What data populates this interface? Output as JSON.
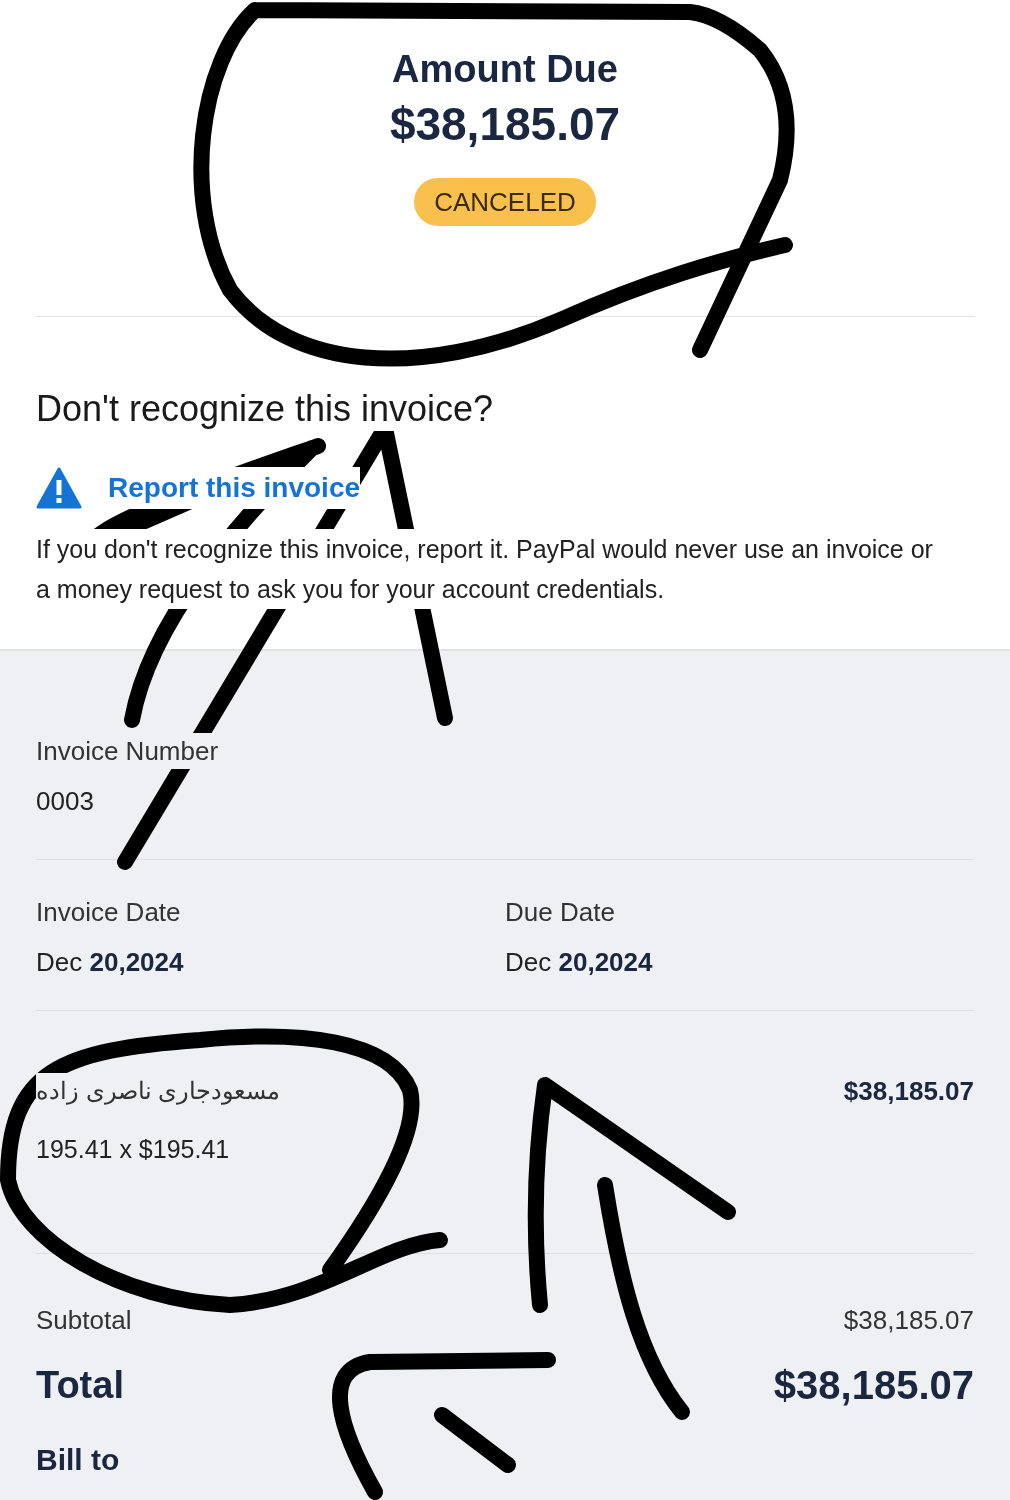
{
  "amount_due": {
    "label": "Amount Due",
    "value": "$38,185.07",
    "status": "CANCELED"
  },
  "warning": {
    "title": "Don't recognize this invoice?",
    "link": "Report this invoice",
    "text": "If you don't recognize this invoice, report it. PayPal would never use an invoice or a money request to ask you for your account credentials."
  },
  "invoice_number": {
    "label": "Invoice Number",
    "value": "0003"
  },
  "dates": [
    {
      "label": "Invoice Date",
      "month": "Dec",
      "day_year": "20,2024"
    },
    {
      "label": "Due Date",
      "month": "Dec",
      "day_year": "20,2024"
    }
  ],
  "items": [
    {
      "name": "مسعودجاری ناصری زاده",
      "quantity": "195.41 x $195.41",
      "amount": "$38,185.07"
    }
  ],
  "totals": {
    "subtotal_label": "Subtotal",
    "subtotal": "$38,185.07",
    "total_label": "Total",
    "total": "$38,185.07"
  },
  "bill_to": {
    "label": "Bill to"
  }
}
